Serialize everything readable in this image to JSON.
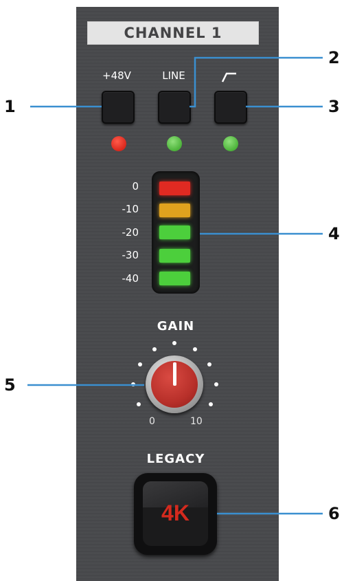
{
  "channel": {
    "title": "CHANNEL 1"
  },
  "buttons": [
    {
      "label": "+48V",
      "led": "red"
    },
    {
      "label": "LINE",
      "led": "green"
    },
    {
      "label": "",
      "icon": "high-pass-filter-icon",
      "led": "green"
    }
  ],
  "meter": {
    "labels": [
      "0",
      "-10",
      "-20",
      "-30",
      "-40"
    ],
    "colors": [
      "#e02a22",
      "#e0a21e",
      "#4ccf3c",
      "#4ccf3c",
      "#4ccf3c"
    ]
  },
  "gain": {
    "label": "GAIN",
    "min_label": "0",
    "max_label": "10"
  },
  "legacy": {
    "label": "LEGACY",
    "button_text": "4K"
  },
  "callouts": [
    "1",
    "2",
    "3",
    "4",
    "5",
    "6"
  ],
  "colors": {
    "callout_line": "#3a8fd0",
    "led_red": "#e0271c",
    "led_green": "#5cc044"
  }
}
